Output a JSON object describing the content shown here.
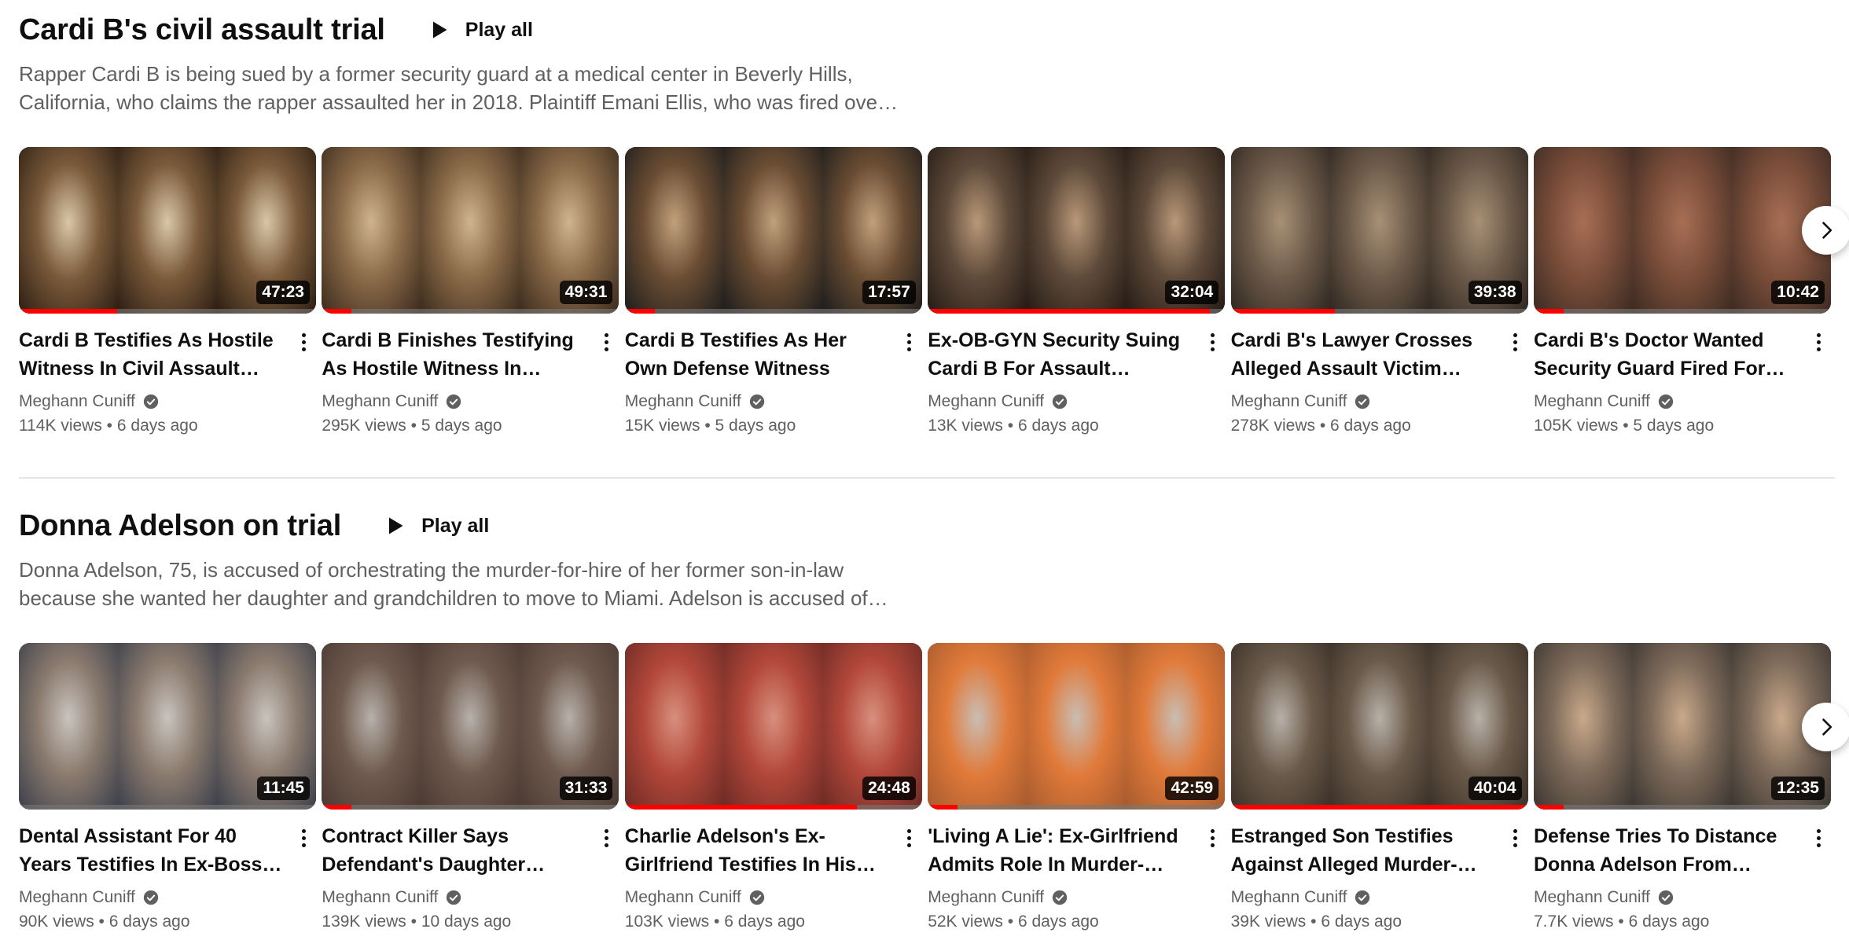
{
  "colors": {
    "progress": "#ff0000",
    "text_primary": "#0f0f0f",
    "text_secondary": "#606060",
    "divider": "#e5e5e5"
  },
  "shelves": [
    {
      "title": "Cardi B's civil assault trial",
      "play_all_label": "Play all",
      "play_icon": "play-icon",
      "description": "Rapper Cardi B is being sued by a former security guard at a medical center in Beverly Hills, California, who claims the rapper assaulted her in 2018. Plaintiff Emani Ellis, who was fired over t…",
      "next_icon": "chevron-right-icon",
      "videos": [
        {
          "title": "Cardi B Testifies As Hostile Witness In Civil Assault Tria…",
          "channel": "Meghann Cuniff",
          "views": "114K views",
          "age": "6 days ago",
          "duration": "47:23",
          "watched": 0.33
        },
        {
          "title": "Cardi B Finishes Testifying As Hostile Witness In Civil…",
          "channel": "Meghann Cuniff",
          "views": "295K views",
          "age": "5 days ago",
          "duration": "49:31",
          "watched": 0.1
        },
        {
          "title": "Cardi B Testifies As Her Own Defense Witness",
          "channel": "Meghann Cuniff",
          "views": "15K views",
          "age": "5 days ago",
          "duration": "17:57",
          "watched": 0.1
        },
        {
          "title": "Ex-OB-GYN Security Suing Cardi B For Assault Testifie…",
          "channel": "Meghann Cuniff",
          "views": "13K views",
          "age": "6 days ago",
          "duration": "32:04",
          "watched": 0.95
        },
        {
          "title": "Cardi B's Lawyer Crosses Alleged Assault Victim Abo…",
          "channel": "Meghann Cuniff",
          "views": "278K views",
          "age": "6 days ago",
          "duration": "39:38",
          "watched": 0.35
        },
        {
          "title": "Cardi B's Doctor Wanted Security Guard Fired For…",
          "channel": "Meghann Cuniff",
          "views": "105K views",
          "age": "5 days ago",
          "duration": "10:42",
          "watched": 0.1
        }
      ]
    },
    {
      "title": "Donna Adelson on trial",
      "play_all_label": "Play all",
      "play_icon": "play-icon",
      "description": "Donna Adelson, 75, is accused of orchestrating the murder-for-hire of her former son-in-law because she wanted her daughter and grandchildren to move to Miami. Adelson is accused of…",
      "next_icon": "chevron-right-icon",
      "videos": [
        {
          "title": "Dental Assistant For 40 Years Testifies In Ex-Boss' Murder…",
          "channel": "Meghann Cuniff",
          "views": "90K views",
          "age": "6 days ago",
          "duration": "11:45",
          "watched": 0
        },
        {
          "title": "Contract Killer Says Defendant's Daughter Want…",
          "channel": "Meghann Cuniff",
          "views": "139K views",
          "age": "10 days ago",
          "duration": "31:33",
          "watched": 0.1
        },
        {
          "title": "Charlie Adelson's Ex-Girlfriend Testifies In His…",
          "channel": "Meghann Cuniff",
          "views": "103K views",
          "age": "6 days ago",
          "duration": "24:48",
          "watched": 0.78
        },
        {
          "title": "'Living A Lie': Ex-Girlfriend Admits Role In Murder-For-…",
          "channel": "Meghann Cuniff",
          "views": "52K views",
          "age": "6 days ago",
          "duration": "42:59",
          "watched": 0.1
        },
        {
          "title": "Estranged Son Testifies Against Alleged Murder-For…",
          "channel": "Meghann Cuniff",
          "views": "39K views",
          "age": "6 days ago",
          "duration": "40:04",
          "watched": 1.0
        },
        {
          "title": "Defense Tries To Distance Donna Adelson From Son's…",
          "channel": "Meghann Cuniff",
          "views": "7.7K views",
          "age": "6 days ago",
          "duration": "12:35",
          "watched": 0.1
        }
      ]
    }
  ]
}
